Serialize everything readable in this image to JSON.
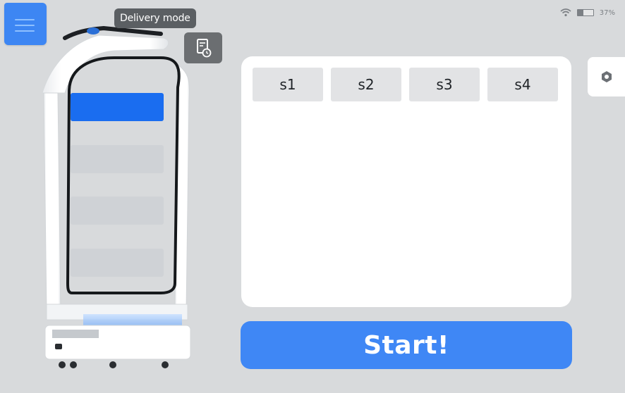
{
  "top_bar": {
    "menu_icon": "hamburger-menu-icon",
    "mode_label": "Delivery mode",
    "mode_icon": "document-clock-icon",
    "status": {
      "wifi_icon": "wifi-icon",
      "battery_icon": "battery-icon",
      "battery_text": "37%",
      "battery_level": 0.37
    }
  },
  "robot": {
    "trays": [
      {
        "state": "selected"
      },
      {
        "state": "empty"
      },
      {
        "state": "empty"
      },
      {
        "state": "empty"
      }
    ]
  },
  "stations": {
    "tabs": [
      {
        "label": "s1"
      },
      {
        "label": "s2"
      },
      {
        "label": "s3"
      },
      {
        "label": "s4"
      }
    ]
  },
  "settings_icon": "gear-icon",
  "actions": {
    "start_label": "Start!"
  },
  "colors": {
    "background": "#d8dadc",
    "accent": "#3f87f5",
    "tray_selected": "#1a6df0",
    "tray_empty": "#cfd2d6",
    "panel": "#ffffff",
    "pill": "#5b5f63"
  }
}
